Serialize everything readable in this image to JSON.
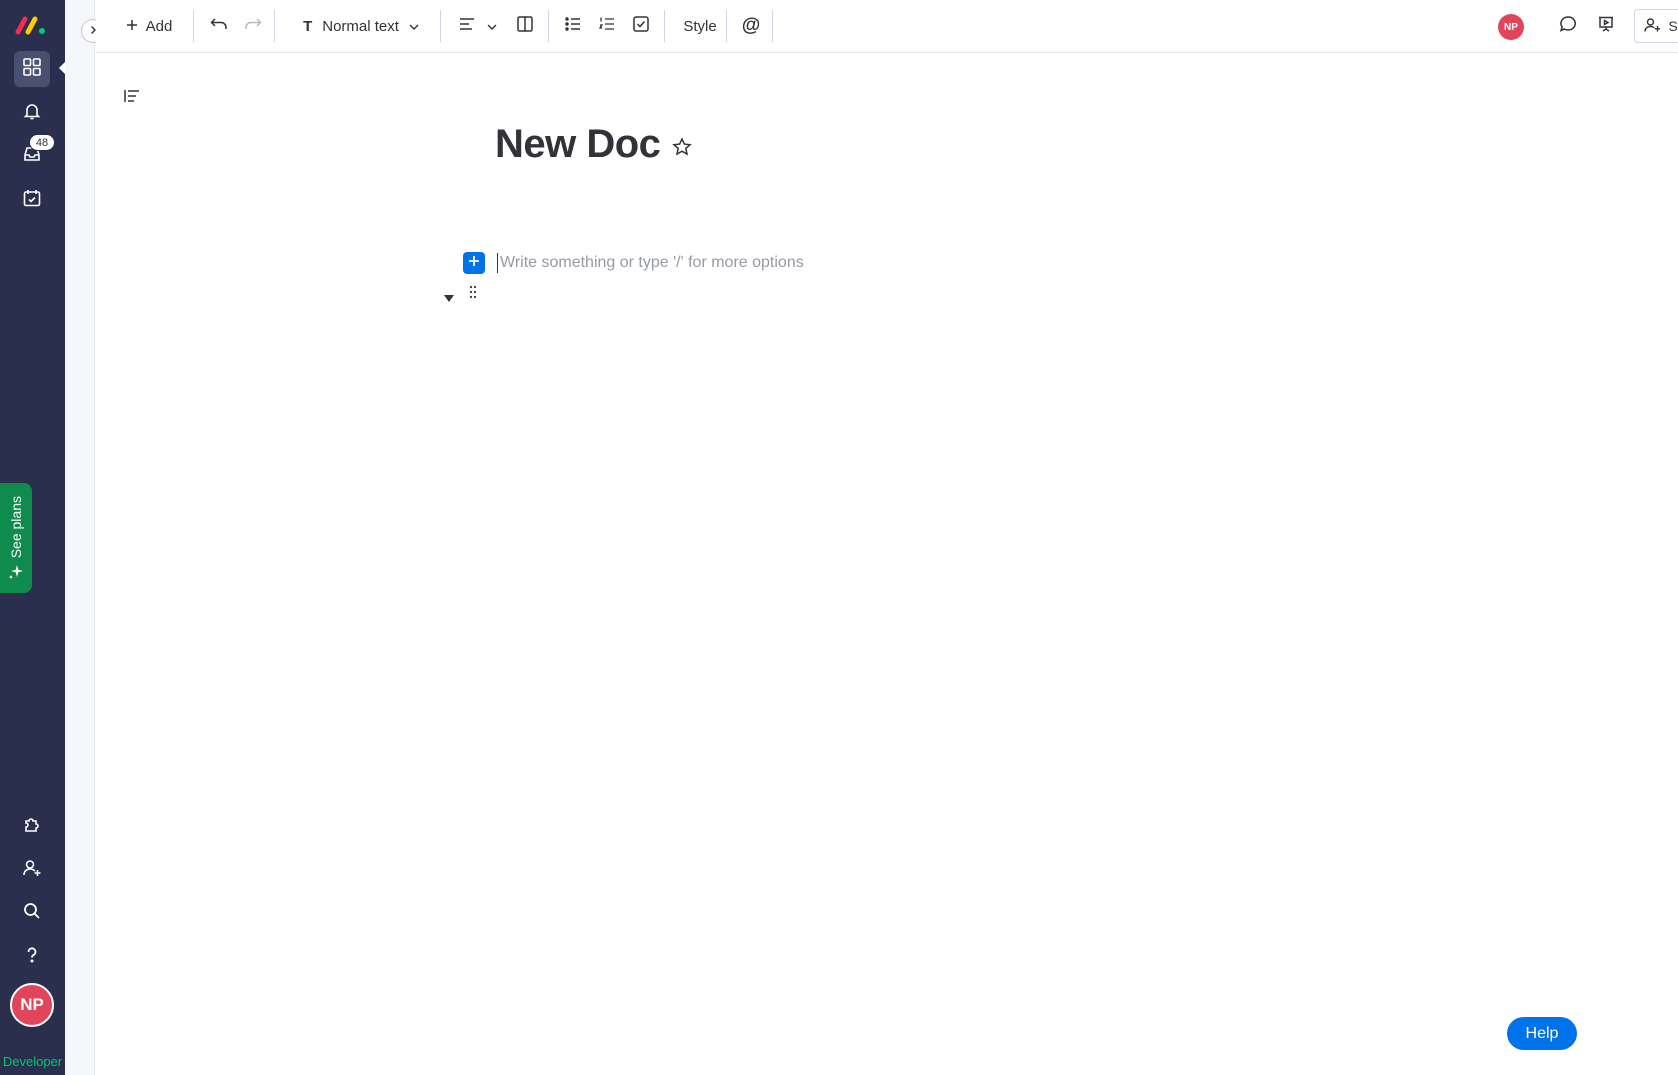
{
  "rail": {
    "notifications_badge": "48",
    "see_plans_label": "See plans",
    "avatar_initials": "NP",
    "footer_label": "Developer"
  },
  "toolbar": {
    "add_label": "Add",
    "text_style_label": "Normal text",
    "style_label": "Style",
    "share_label": "Share",
    "avatar_initials": "NP"
  },
  "document": {
    "title": "New Doc",
    "placeholder": "Write something or type '/' for more options"
  },
  "help_label": "Help",
  "colors": {
    "rail": "#292f4c",
    "primary": "#0073ea",
    "avatar": "#e2445c",
    "see_plans": "#0f8b4e",
    "developer": "#00c875"
  }
}
